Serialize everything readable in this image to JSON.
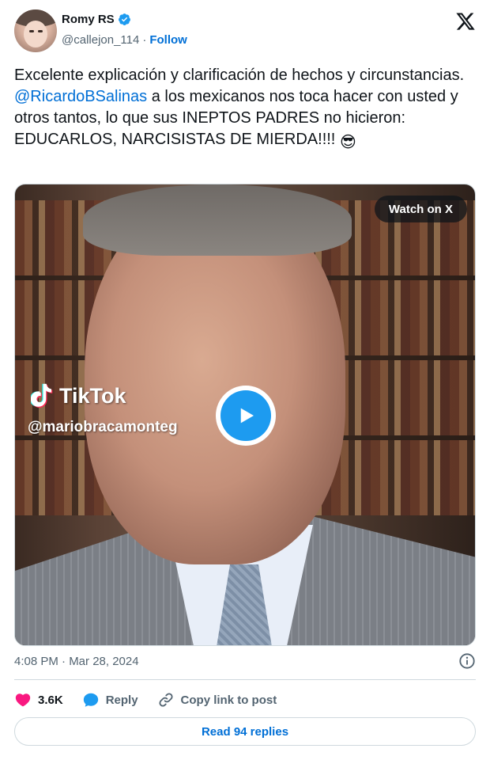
{
  "author": {
    "display_name": "Romy RS",
    "handle": "@callejon_114",
    "separator": "·",
    "follow_label": "Follow",
    "verified": true
  },
  "tweet": {
    "text_before": "Excelente explicación y clarificación de hechos y circunstancias. ",
    "mention": "@RicardoBSalinas",
    "text_after": " a los mexicanos nos toca hacer con usted y otros tantos, lo que sus INEPTOS PADRES no hicieron: EDUCARLOS, NARCISISTAS DE MIERDA!!!! ",
    "emoji": "😎"
  },
  "media": {
    "watch_label": "Watch on X",
    "watermark_brand": "TikTok",
    "watermark_handle": "@mariobracamonteg"
  },
  "meta": {
    "timestamp": "4:08 PM · Mar 28, 2024"
  },
  "actions": {
    "likes": "3.6K",
    "reply_label": "Reply",
    "copy_label": "Copy link to post"
  },
  "footer": {
    "read_replies_label": "Read 94 replies"
  },
  "colors": {
    "link_blue": "#006fd6",
    "play_blue": "#1d9bf0",
    "heart_pink": "#f91880",
    "muted": "#536471"
  },
  "icons": [
    "verified-badge-icon",
    "x-logo-icon",
    "play-icon",
    "tiktok-icon",
    "info-icon",
    "heart-icon",
    "reply-bubble-icon",
    "link-icon"
  ]
}
